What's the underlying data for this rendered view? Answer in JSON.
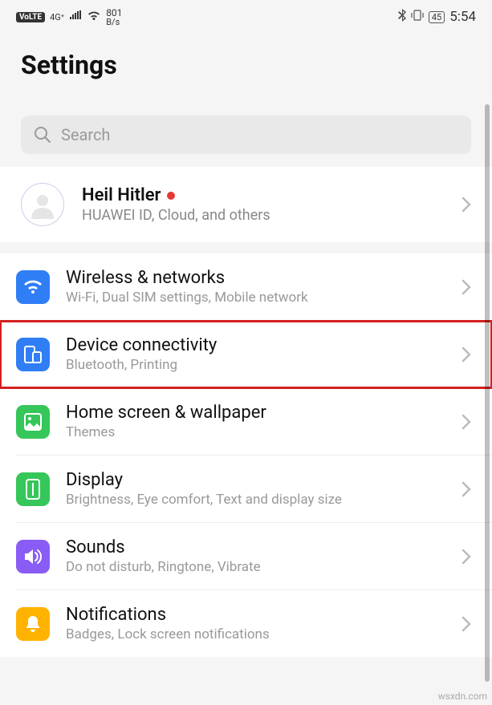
{
  "status": {
    "volte": "VoLTE",
    "signal_gen": "4G⁺",
    "net_speed_value": "801",
    "net_speed_unit": "B/s",
    "battery": "45",
    "time": "5:54"
  },
  "header": {
    "title": "Settings"
  },
  "search": {
    "placeholder": "Search"
  },
  "account": {
    "name": "Heil Hitler",
    "subtitle": "HUAWEI ID, Cloud, and others"
  },
  "items": [
    {
      "title": "Wireless & networks",
      "subtitle": "Wi-Fi, Dual SIM settings, Mobile network",
      "icon": "wifi",
      "color": "#2f7ef6",
      "highlight": false
    },
    {
      "title": "Device connectivity",
      "subtitle": "Bluetooth, Printing",
      "icon": "device",
      "color": "#2f7ef6",
      "highlight": true
    },
    {
      "title": "Home screen & wallpaper",
      "subtitle": "Themes",
      "icon": "wallpaper",
      "color": "#35c759",
      "highlight": false
    },
    {
      "title": "Display",
      "subtitle": "Brightness, Eye comfort, Text and display size",
      "icon": "display",
      "color": "#35c759",
      "highlight": false
    },
    {
      "title": "Sounds",
      "subtitle": "Do not disturb, Ringtone, Vibrate",
      "icon": "sounds",
      "color": "#8a5cf6",
      "highlight": false
    },
    {
      "title": "Notifications",
      "subtitle": "Badges, Lock screen notifications",
      "icon": "notifications",
      "color": "#ffb300",
      "highlight": false
    }
  ],
  "watermark": "wsxdn.com"
}
